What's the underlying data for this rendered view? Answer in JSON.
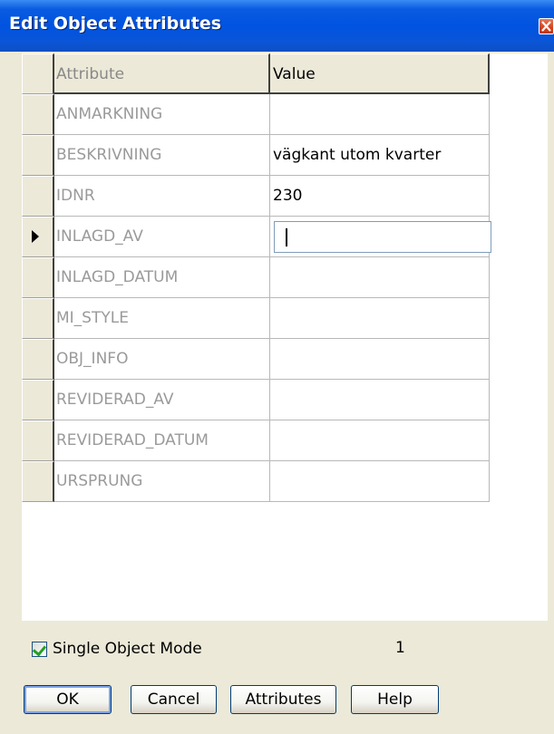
{
  "window": {
    "title": "Edit Object Attributes"
  },
  "grid": {
    "headers": {
      "attribute": "Attribute",
      "value": "Value"
    },
    "rows": [
      {
        "attribute": "ANMARKNING",
        "value": ""
      },
      {
        "attribute": "BESKRIVNING",
        "value": "vägkant utom kvarter"
      },
      {
        "attribute": "IDNR",
        "value": "230"
      },
      {
        "attribute": "INLAGD_AV",
        "value": ""
      },
      {
        "attribute": "INLAGD_DATUM",
        "value": ""
      },
      {
        "attribute": "MI_STYLE",
        "value": ""
      },
      {
        "attribute": "OBJ_INFO",
        "value": ""
      },
      {
        "attribute": "REVIDERAD_AV",
        "value": ""
      },
      {
        "attribute": "REVIDERAD_DATUM",
        "value": ""
      },
      {
        "attribute": "URSPRUNG",
        "value": ""
      }
    ],
    "current_row": 3
  },
  "footer": {
    "single_object_mode_label": "Single Object Mode",
    "single_object_mode_checked": true,
    "object_count": "1"
  },
  "buttons": {
    "ok": "OK",
    "cancel": "Cancel",
    "attributes": "Attributes",
    "help": "Help"
  },
  "colors": {
    "title_bar": "#0053e1",
    "dialog_bg": "#ece9d8",
    "attribute_text": "#9a9a9a"
  }
}
